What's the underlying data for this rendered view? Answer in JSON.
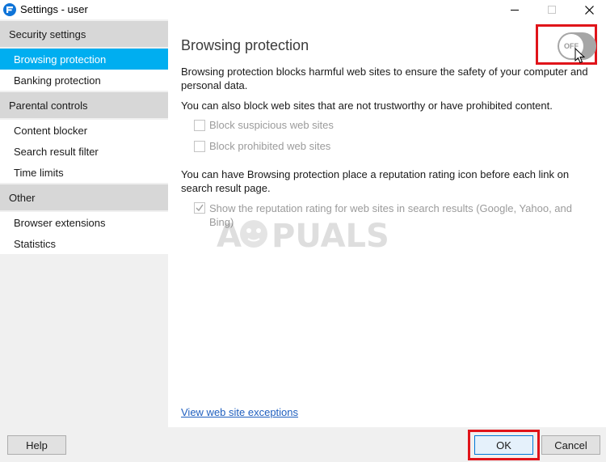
{
  "window": {
    "title": "Settings - user",
    "controls": [
      "minimize",
      "maximize",
      "close"
    ]
  },
  "sidebar": {
    "sections": [
      {
        "header": "Security settings",
        "items": [
          {
            "label": "Browsing protection",
            "active": true
          },
          {
            "label": "Banking protection",
            "active": false
          }
        ]
      },
      {
        "header": "Parental controls",
        "items": [
          {
            "label": "Content blocker",
            "active": false
          },
          {
            "label": "Search result filter",
            "active": false
          },
          {
            "label": "Time limits",
            "active": false
          }
        ]
      },
      {
        "header": "Other",
        "items": [
          {
            "label": "Browser extensions",
            "active": false
          },
          {
            "label": "Statistics",
            "active": false
          }
        ]
      }
    ]
  },
  "main": {
    "title": "Browsing protection",
    "toggle": {
      "state": "OFF",
      "on": false
    },
    "description": "Browsing protection blocks harmful web sites to ensure the safety of your computer and personal data.",
    "block_intro": "You can also block web sites that are not trustworthy or have prohibited content.",
    "options": [
      {
        "label": "Block suspicious web sites",
        "checked": false,
        "enabled": false
      },
      {
        "label": "Block prohibited web sites",
        "checked": false,
        "enabled": false
      }
    ],
    "rating_intro": "You can have Browsing protection place a reputation rating icon before each link on search result page.",
    "rating_option": {
      "label": "Show the reputation rating for web sites in search results (Google, Yahoo, and Bing)",
      "checked": true,
      "enabled": false
    },
    "exceptions_link": "View web site exceptions"
  },
  "watermark": "APPUALS",
  "footer": {
    "help_label": "Help",
    "ok_label": "OK",
    "cancel_label": "Cancel"
  },
  "colors": {
    "accent": "#00aef0",
    "highlight": "#e0141a",
    "link": "#1f5fbf",
    "sidebar_bg": "#f0f0f0",
    "section_bg": "#d7d7d7"
  }
}
